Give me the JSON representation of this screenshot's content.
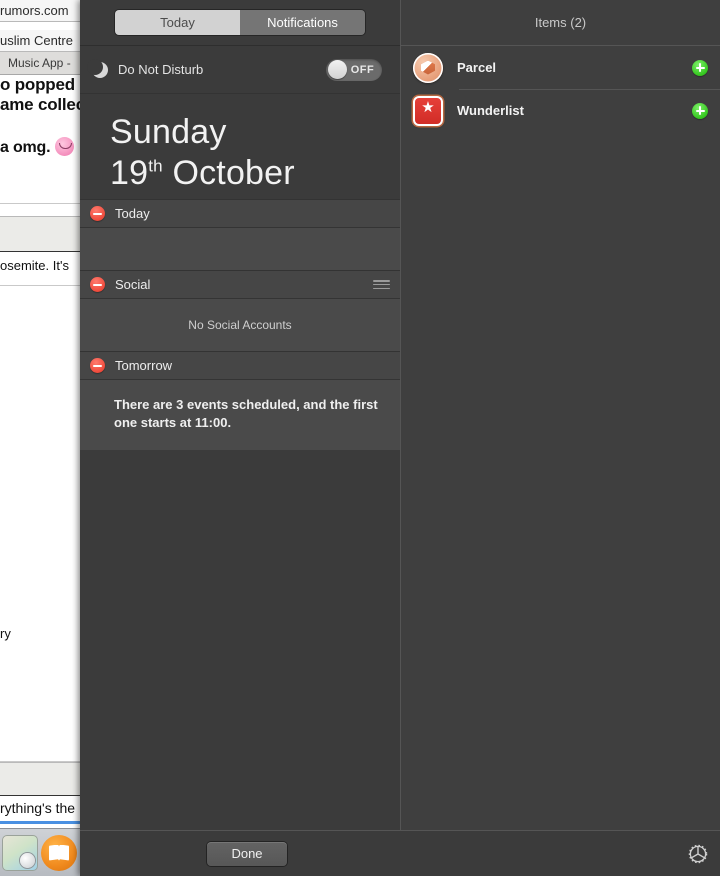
{
  "desktop": {
    "browser_lines": [
      "rumors.com",
      "uslim Centre",
      "Music App - ",
      "o popped bac",
      "ame collectio",
      "a omg. ",
      "osemite. It's",
      "ry",
      "rything's the"
    ],
    "dock_items": [
      "maps-icon",
      "ibooks-icon",
      "photo-booth-icon"
    ]
  },
  "notification_center": {
    "tabs": [
      {
        "label": "Today",
        "active": false
      },
      {
        "label": "Notifications",
        "active": true
      }
    ],
    "do_not_disturb": {
      "icon": "moon-icon",
      "label": "Do Not Disturb",
      "state": "OFF"
    },
    "date": {
      "weekday": "Sunday",
      "day": "19",
      "ordinal": "th",
      "month": "October"
    },
    "widgets": [
      {
        "title": "Today",
        "remove_icon": "minus-circle-icon",
        "has_grip": false,
        "body": ""
      },
      {
        "title": "Social",
        "remove_icon": "minus-circle-icon",
        "has_grip": true,
        "body": "No Social Accounts"
      },
      {
        "title": "Tomorrow",
        "remove_icon": "minus-circle-icon",
        "has_grip": false,
        "body": "There are 3 events scheduled, and the first one starts at 11:00."
      }
    ],
    "items_panel": {
      "header": "Items (2)",
      "items": [
        {
          "name": "Parcel",
          "icon": "parcel-app-icon",
          "add_icon": "plus-circle-icon"
        },
        {
          "name": "Wunderlist",
          "icon": "wunderlist-app-icon",
          "add_icon": "plus-circle-icon"
        }
      ]
    },
    "footer": {
      "done_label": "Done",
      "settings_icon": "gear-icon"
    }
  },
  "colors": {
    "panel_background": "#3b3b3b",
    "widget_body": "#4a4a4a",
    "accent_remove": "#ef4b3c",
    "accent_add": "#35c71f",
    "tab_active": "#757575",
    "tab_inactive": "#d2d2d2"
  }
}
